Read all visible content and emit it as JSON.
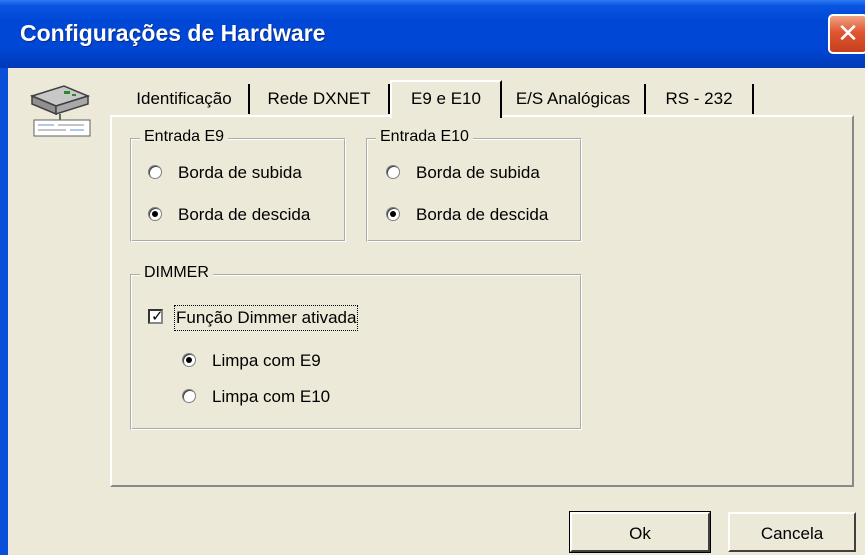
{
  "window": {
    "title": "Configurações de Hardware",
    "close_symbol": "✕"
  },
  "tabs": [
    {
      "label": "Identificação"
    },
    {
      "label": "Rede DXNET"
    },
    {
      "label": "E9 e E10"
    },
    {
      "label": "E/S Analógicas"
    },
    {
      "label": "RS - 232"
    }
  ],
  "active_tab": "E9 e E10",
  "entrada_e9": {
    "legend": "Entrada E9",
    "options": [
      "Borda de subida",
      "Borda de descida"
    ],
    "selected": "Borda de descida"
  },
  "entrada_e10": {
    "legend": "Entrada E10",
    "options": [
      "Borda de subida",
      "Borda de descida"
    ],
    "selected": "Borda de descida"
  },
  "dimmer": {
    "legend": "DIMMER",
    "checkbox_label": "Função Dimmer ativada",
    "checked": true,
    "options": [
      "Limpa com E9",
      "Limpa com E10"
    ],
    "selected": "Limpa com E9"
  },
  "buttons": {
    "ok": "Ok",
    "cancel": "Cancela"
  },
  "icons": [
    "hardware-device-icon",
    "close-icon"
  ],
  "colors": {
    "titlebar": "#0047d6",
    "close": "#e0562f",
    "face": "#ece9d8"
  }
}
